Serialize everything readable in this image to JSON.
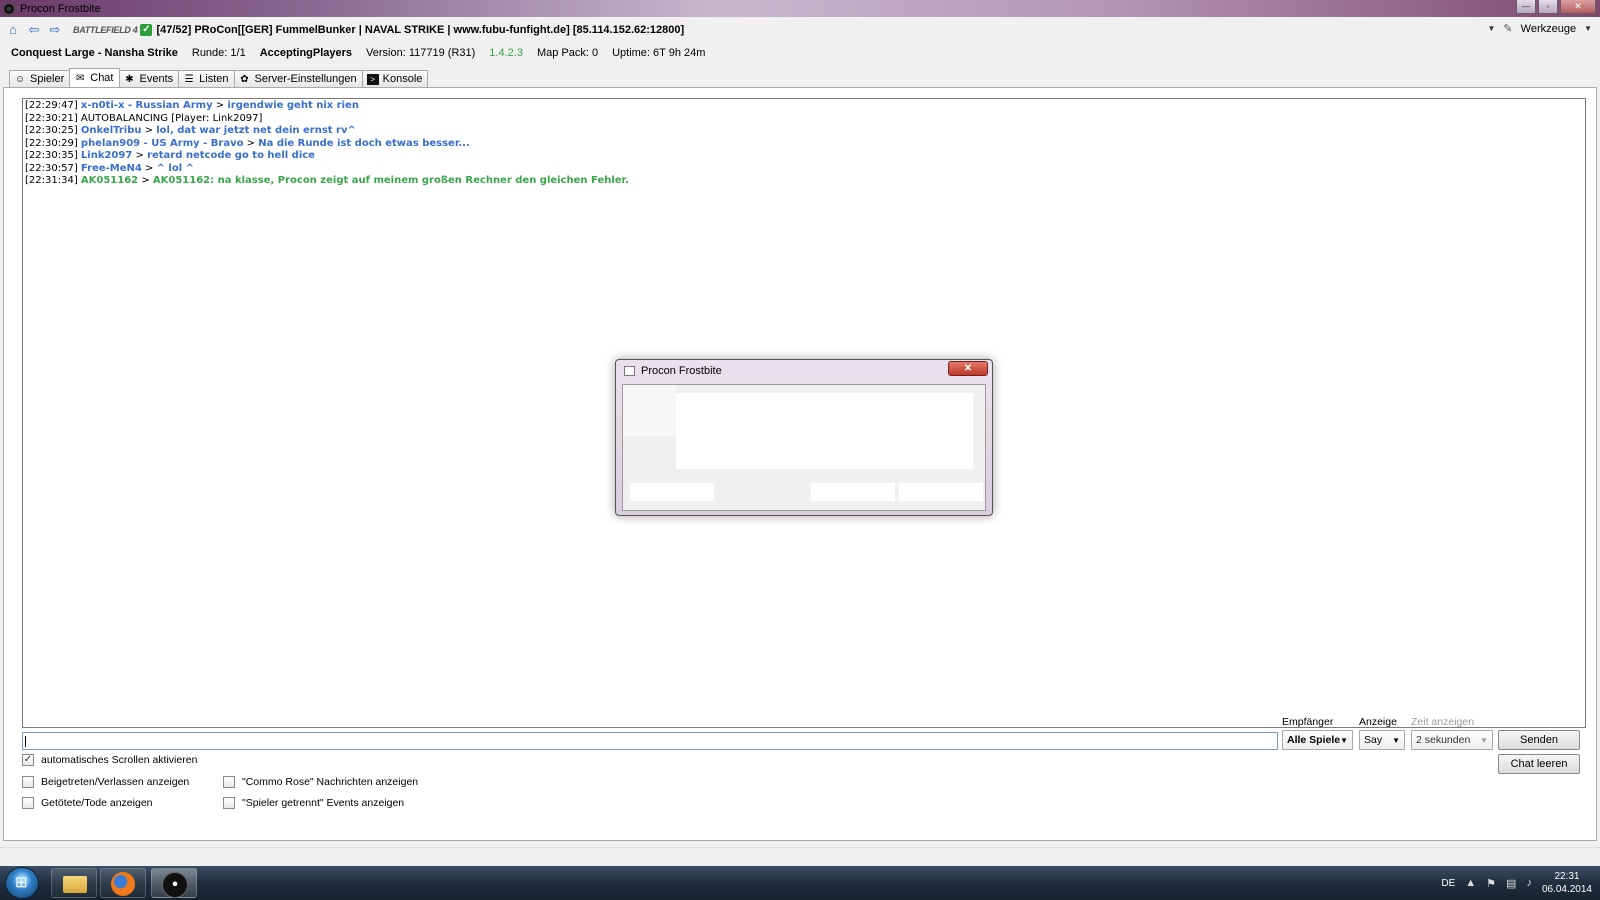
{
  "window": {
    "title": "Procon Frostbite",
    "minimize": "—",
    "maximize": "▫",
    "close": "✕"
  },
  "server_bar": {
    "game_logo": "BATTLEFIELD 4",
    "server_name": "[47/52] PRoCon[[GER] FummelBunker | NAVAL STRIKE | www.fubu-funfight.de] [85.114.152.62:12800]",
    "tools_label": "Werkzeuge"
  },
  "status": {
    "map": "Conquest Large - Nansha Strike",
    "round": "Runde: 1/1",
    "state": "AcceptingPlayers",
    "version": "Version: 117719 (R31)",
    "procon_version": "1.4.2.3",
    "map_pack": "Map Pack: 0",
    "uptime": "Uptime: 6T 9h 24m"
  },
  "tabs": [
    {
      "label": "Spieler",
      "icon": "player-icon"
    },
    {
      "label": "Chat",
      "icon": "chat-icon"
    },
    {
      "label": "Events",
      "icon": "events-icon"
    },
    {
      "label": "Listen",
      "icon": "list-icon"
    },
    {
      "label": "Server-Einstellungen",
      "icon": "settings-icon"
    },
    {
      "label": "Konsole",
      "icon": "console-icon"
    }
  ],
  "chat": [
    {
      "ts": "[22:29:47]",
      "who": "x-n0ti-x - Russian Army",
      "sep": " > ",
      "msg": "irgendwie geht nix rien"
    },
    {
      "ts": "[22:30:21]",
      "who": "",
      "sep": "",
      "msg": "AUTOBALANCING [Player: Link2097]"
    },
    {
      "ts": "[22:30:25]",
      "who": "OnkelTribu",
      "sep": " > ",
      "msg": "lol, dat war jetzt net dein ernst rv^"
    },
    {
      "ts": "[22:30:29]",
      "who": "phelan909 - US Army - Bravo",
      "sep": " > ",
      "msg": "Na die Runde ist doch etwas besser..."
    },
    {
      "ts": "[22:30:35]",
      "who": "Link2097",
      "sep": " > ",
      "msg": "retard netcode go to hell dice"
    },
    {
      "ts": "[22:30:57]",
      "who": "Free-MeN4",
      "sep": " > ",
      "msg": "^ lol ^"
    },
    {
      "ts": "[22:31:34]",
      "who": "AK051162",
      "sep": " > ",
      "msg": "AK051162: na klasse, Procon zeigt auf meinem großen Rechner den gleichen Fehler."
    }
  ],
  "send_area": {
    "recipient_label": "Empfänger",
    "recipient_value": "Alle Spiele",
    "display_label": "Anzeige",
    "display_value": "Say",
    "time_label": "Zeit anzeigen",
    "time_value": "2 sekunden",
    "send_button": "Senden",
    "clear_button": "Chat leeren"
  },
  "options": {
    "autoscroll": {
      "label": "automatisches Scrollen aktivieren",
      "checked": true
    },
    "join_leave": {
      "label": "Beigetreten/Verlassen anzeigen",
      "checked": false
    },
    "killed": {
      "label": "Getötete/Tode anzeigen",
      "checked": false
    },
    "commo_rose": {
      "label": "\"Commo Rose\" Nachrichten anzeigen",
      "checked": false
    },
    "disconnected": {
      "label": "\"Spieler getrennt\" Events anzeigen",
      "checked": false
    }
  },
  "dialog": {
    "title": "Procon Frostbite",
    "close": "✕"
  },
  "taskbar": {
    "language": "DE",
    "time": "22:31",
    "date": "06.04.2014"
  }
}
